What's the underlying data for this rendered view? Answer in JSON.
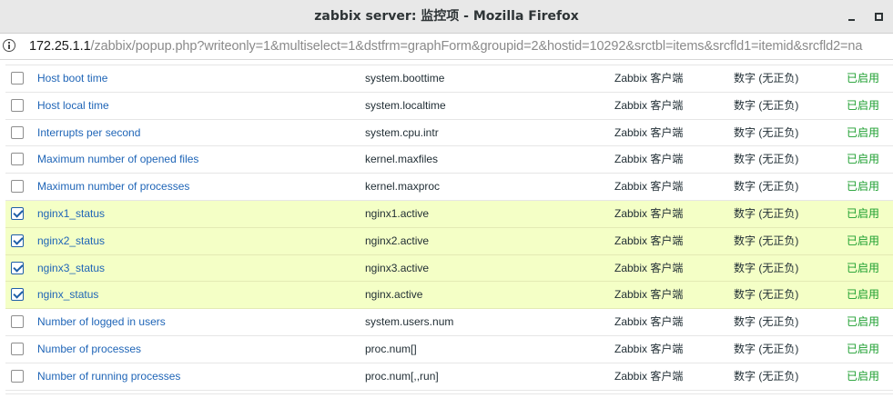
{
  "window": {
    "title": "zabbix server: 监控项 - Mozilla Firefox"
  },
  "urlbar": {
    "host": "172.25.1.1",
    "rest": "/zabbix/popup.php?writeonly=1&multiselect=1&dstfrm=graphForm&groupid=2&hostid=10292&srctbl=items&srcfld1=itemid&srcfld2=na"
  },
  "items": [
    {
      "name": "Host boot time",
      "key": "system.boottime",
      "type": "Zabbix 客户端",
      "info": "数字 (无正负)",
      "status": "已启用",
      "checked": false
    },
    {
      "name": "Host local time",
      "key": "system.localtime",
      "type": "Zabbix 客户端",
      "info": "数字 (无正负)",
      "status": "已启用",
      "checked": false
    },
    {
      "name": "Interrupts per second",
      "key": "system.cpu.intr",
      "type": "Zabbix 客户端",
      "info": "数字 (无正负)",
      "status": "已启用",
      "checked": false
    },
    {
      "name": "Maximum number of opened files",
      "key": "kernel.maxfiles",
      "type": "Zabbix 客户端",
      "info": "数字 (无正负)",
      "status": "已启用",
      "checked": false
    },
    {
      "name": "Maximum number of processes",
      "key": "kernel.maxproc",
      "type": "Zabbix 客户端",
      "info": "数字 (无正负)",
      "status": "已启用",
      "checked": false
    },
    {
      "name": "nginx1_status",
      "key": "nginx1.active",
      "type": "Zabbix 客户端",
      "info": "数字 (无正负)",
      "status": "已启用",
      "checked": true
    },
    {
      "name": "nginx2_status",
      "key": "nginx2.active",
      "type": "Zabbix 客户端",
      "info": "数字 (无正负)",
      "status": "已启用",
      "checked": true
    },
    {
      "name": "nginx3_status",
      "key": "nginx3.active",
      "type": "Zabbix 客户端",
      "info": "数字 (无正负)",
      "status": "已启用",
      "checked": true
    },
    {
      "name": "nginx_status",
      "key": "nginx.active",
      "type": "Zabbix 客户端",
      "info": "数字 (无正负)",
      "status": "已启用",
      "checked": true
    },
    {
      "name": "Number of logged in users",
      "key": "system.users.num",
      "type": "Zabbix 客户端",
      "info": "数字 (无正负)",
      "status": "已启用",
      "checked": false
    },
    {
      "name": "Number of processes",
      "key": "proc.num[]",
      "type": "Zabbix 客户端",
      "info": "数字 (无正负)",
      "status": "已启用",
      "checked": false
    },
    {
      "name": "Number of running processes",
      "key": "proc.num[,,run]",
      "type": "Zabbix 客户端",
      "info": "数字 (无正负)",
      "status": "已启用",
      "checked": false
    }
  ]
}
